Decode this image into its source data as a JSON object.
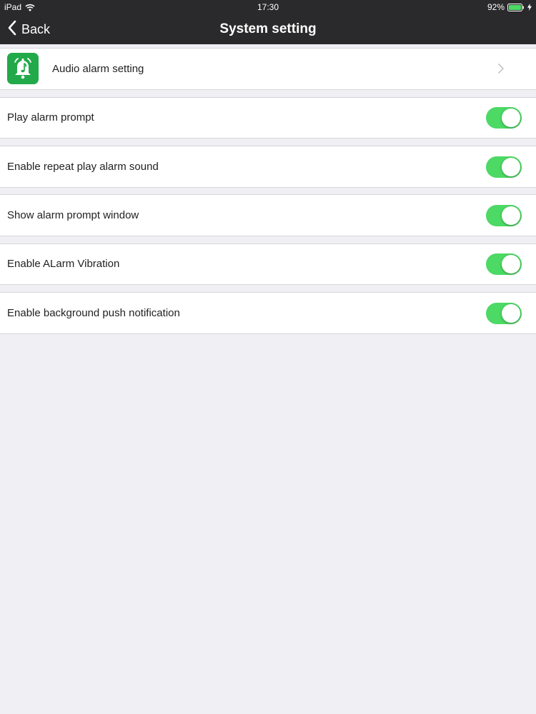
{
  "status_bar": {
    "device": "iPad",
    "time": "17:30",
    "battery": "92%"
  },
  "nav": {
    "back_label": "Back",
    "title": "System setting"
  },
  "audio_row": {
    "label": "Audio alarm setting",
    "icon": "alarm-bell-music-icon",
    "icon_color": "#22a94a"
  },
  "toggles": [
    {
      "label": "Play alarm prompt",
      "on": true
    },
    {
      "label": "Enable repeat play alarm sound",
      "on": true
    },
    {
      "label": "Show alarm prompt window",
      "on": true
    },
    {
      "label": "Enable ALarm Vibration",
      "on": true
    },
    {
      "label": "Enable background push notification",
      "on": true
    }
  ],
  "colors": {
    "toggle_on": "#4cd964",
    "nav_background": "#2a2a2c",
    "page_background": "#efeff4"
  }
}
